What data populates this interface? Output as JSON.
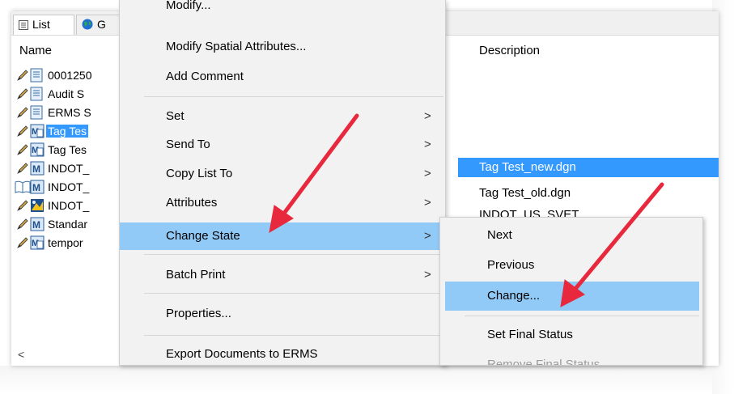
{
  "tabs": [
    {
      "label": "List",
      "icon": "list-icon"
    },
    {
      "label": "G",
      "icon": "globe-icon"
    }
  ],
  "columns": {
    "name": "Name",
    "description": "Description"
  },
  "rows": [
    {
      "name": "0001250",
      "icon": "document-icon",
      "state": "pencil"
    },
    {
      "name": "Audit S",
      "icon": "document-icon",
      "state": "pencil"
    },
    {
      "name": "ERMS S",
      "icon": "document-icon",
      "state": "pencil"
    },
    {
      "name": "Tag Tes",
      "icon": "dgn-file-icon",
      "state": "pencil",
      "selected": true
    },
    {
      "name": "Tag Tes",
      "icon": "dgn-file-icon",
      "state": "pencil"
    },
    {
      "name": "INDOT_",
      "icon": "microstation-icon",
      "state": "pencil"
    },
    {
      "name": "INDOT_",
      "icon": "microstation-icon",
      "state": "book"
    },
    {
      "name": "INDOT_",
      "icon": "image-file-icon",
      "state": "pencil"
    },
    {
      "name": "Standar",
      "icon": "microstation-icon",
      "state": "pencil"
    },
    {
      "name": "tempor",
      "icon": "dgn-file-icon",
      "state": "pencil"
    }
  ],
  "descriptions": [
    {
      "text": "Tag Test_new.dgn",
      "selected": true
    },
    {
      "text": "Tag Test_old.dgn"
    },
    {
      "text": "INDOT_US_SVET"
    }
  ],
  "scroll_left_glyph": "<",
  "menu": {
    "items": [
      {
        "label": "Modify...",
        "submenu": false
      },
      {
        "label": "Modify Spatial Attributes...",
        "submenu": false
      },
      {
        "label": "Add Comment",
        "submenu": false
      },
      {
        "label": "Set",
        "submenu": true
      },
      {
        "label": "Send To",
        "submenu": true
      },
      {
        "label": "Copy List To",
        "submenu": true
      },
      {
        "label": "Attributes",
        "submenu": true
      },
      {
        "label": "Change State",
        "submenu": true,
        "highlighted": true
      },
      {
        "label": "Batch Print",
        "submenu": true
      },
      {
        "label": "Properties...",
        "submenu": false
      },
      {
        "label": "Export Documents to ERMS",
        "submenu": false
      }
    ],
    "submenu_arrow": ">"
  },
  "submenu": {
    "items": [
      {
        "label": "Next"
      },
      {
        "label": "Previous"
      },
      {
        "label": "Change...",
        "highlighted": true
      },
      {
        "label": "Set Final Status"
      },
      {
        "label": "Remove Final Status",
        "disabled": true
      }
    ]
  },
  "colors": {
    "selection": "#3399ff",
    "menu_highlight": "#91c9f7",
    "menu_background": "#f2f2f2",
    "annotation_arrow": "#e8283c"
  }
}
